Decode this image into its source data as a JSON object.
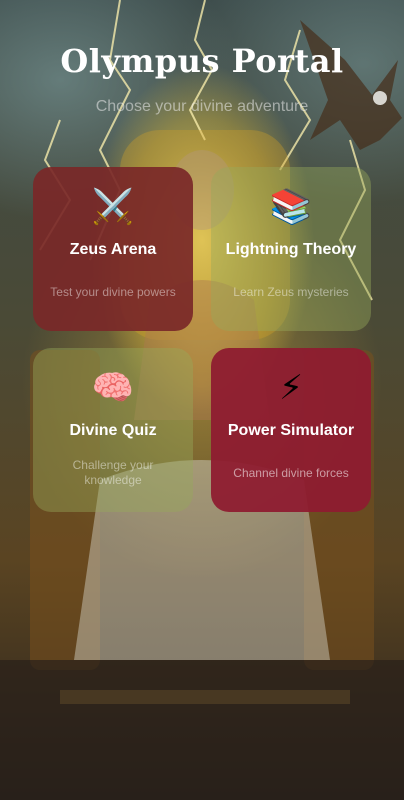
{
  "header": {
    "title": "Olympus Portal",
    "subtitle": "Choose your divine adventure"
  },
  "cards": [
    {
      "icon": "crossed-swords-icon",
      "emoji": "⚔️",
      "title": "Zeus Arena",
      "description": "Test your divine powers"
    },
    {
      "icon": "books-icon",
      "emoji": "📚",
      "title": "Lightning Theory",
      "description": "Learn Zeus mysteries"
    },
    {
      "icon": "brain-icon",
      "emoji": "🧠",
      "title": "Divine Quiz",
      "description": "Challenge your knowledge"
    },
    {
      "icon": "lightning-icon",
      "emoji": "⚡",
      "title": "Power Simulator",
      "description": "Channel divine forces"
    }
  ],
  "colors": {
    "card_red": "#7a2828",
    "card_crimson": "#8e1c30",
    "lightning": "#ffe27a"
  }
}
